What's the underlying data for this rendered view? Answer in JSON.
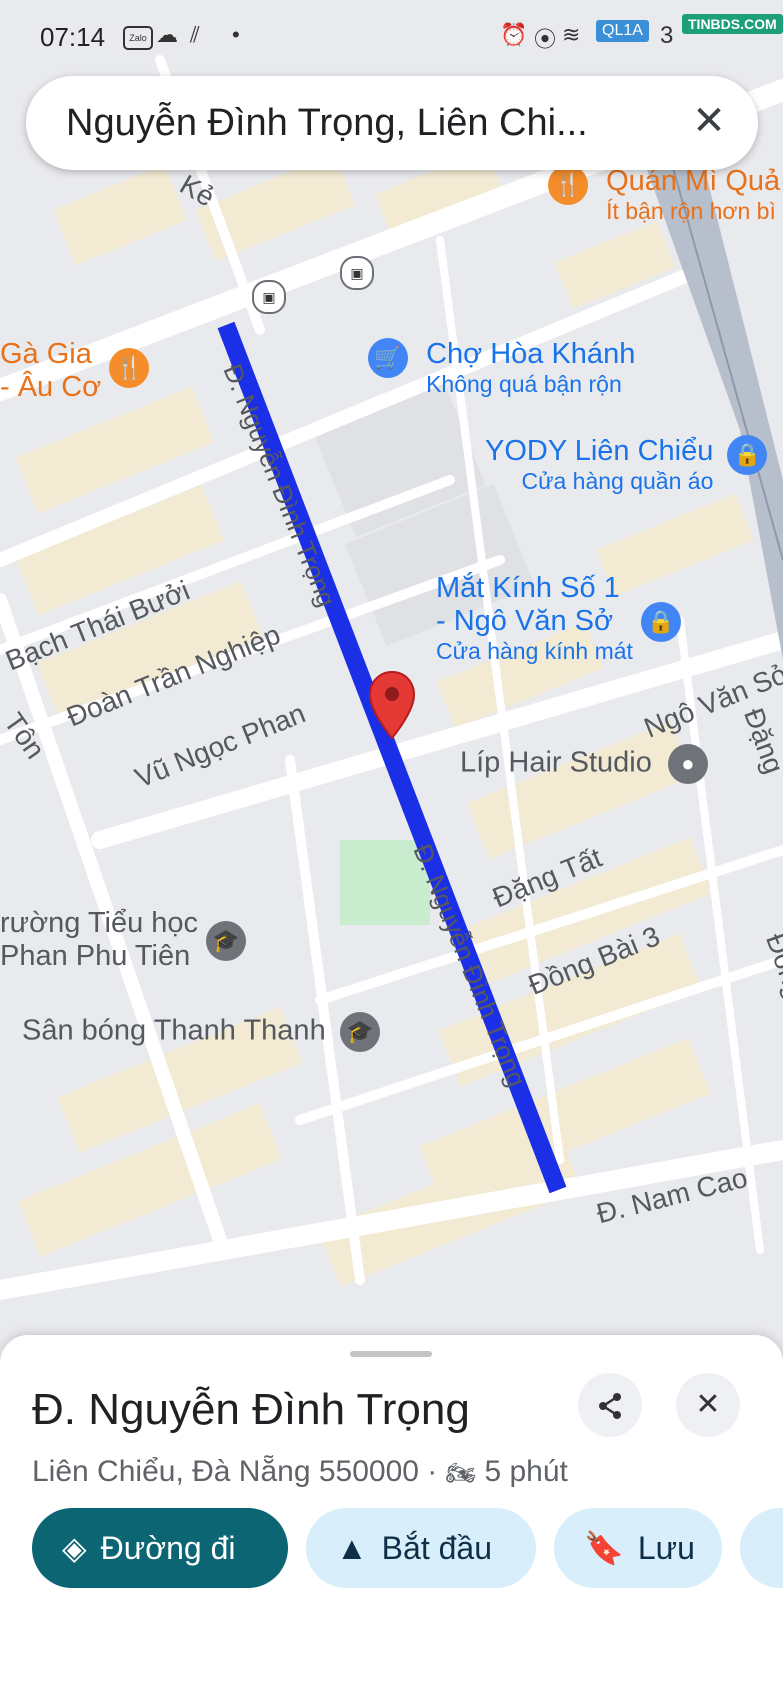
{
  "status_bar": {
    "time": "07:14",
    "zalo_label": "Zalo",
    "icons": [
      "cloud-icon",
      "data-sync-icon",
      "dot-icon",
      "alarm-icon",
      "location-icon",
      "wifi-icon",
      "signal-icon"
    ],
    "overlay_label": "QL1A",
    "battery": "3",
    "watermark": "TINBDS.COM"
  },
  "search": {
    "query": "Nguyễn Đình Trọng, Liên Chi...",
    "close_label": "✕"
  },
  "map": {
    "colors": {
      "background": "#e9eaee",
      "road": "#ffffff",
      "route": "#1a2fe6",
      "building": "#f2ead2",
      "park": "#c9ecce",
      "marker": "#e53935"
    },
    "route_label": "Đ. Nguyễn Đình Trọng",
    "streets": [
      {
        "name": "Bạch Thái Bưởi"
      },
      {
        "name": "Đoàn Trần Nghiệp"
      },
      {
        "name": "Vũ Ngọc Phan"
      },
      {
        "name": "Đặng Tất"
      },
      {
        "name": "Đồng Bài 3"
      },
      {
        "name": "Ngô Văn Sở"
      },
      {
        "name": "Đ. Nam Cao"
      },
      {
        "name": "Tôn"
      },
      {
        "name": "Kẻ"
      },
      {
        "name": "Đặng"
      },
      {
        "name": "Đồng"
      }
    ],
    "places": [
      {
        "name": "Quán Mì Quả",
        "subtitle": "Ít bận rộn hơn bì",
        "icon": "restaurant-icon"
      },
      {
        "name": "Chợ Hòa Khánh",
        "subtitle": "Không quá bận rộn",
        "icon": "shopping-cart-icon"
      },
      {
        "name": "YODY Liên Chiểu",
        "subtitle": "Cửa hàng quần áo",
        "icon": "shopping-bag-icon"
      },
      {
        "name": "Mắt Kính Số 1",
        "name2": "- Ngô Văn Sở",
        "subtitle": "Cửa hàng kính mát",
        "icon": "shopping-bag-icon"
      },
      {
        "name": "Líp Hair Studio",
        "icon": "place-icon"
      },
      {
        "name": "Gà Gia",
        "name2": "- Âu Cơ",
        "icon": "restaurant-icon"
      },
      {
        "name": "rường Tiểu học",
        "name2": "Phan Phu Tiên",
        "icon": "school-icon"
      },
      {
        "name": "Sân bóng Thanh Thanh",
        "icon": "school-icon"
      }
    ]
  },
  "sheet": {
    "title": "Đ. Nguyễn Đình Trọng",
    "location": "Liên Chiểu, Đà Nẵng 550000",
    "separator": "·",
    "travel_time": "5 phút",
    "buttons": [
      {
        "label": "Đường đi",
        "icon": "directions-icon"
      },
      {
        "label": "Bắt đầu",
        "icon": "navigation-arrow-icon"
      },
      {
        "label": "Lưu",
        "icon": "bookmark-icon"
      }
    ]
  },
  "navbar": {
    "recents": "|||",
    "home": "▢",
    "back": "‹"
  }
}
